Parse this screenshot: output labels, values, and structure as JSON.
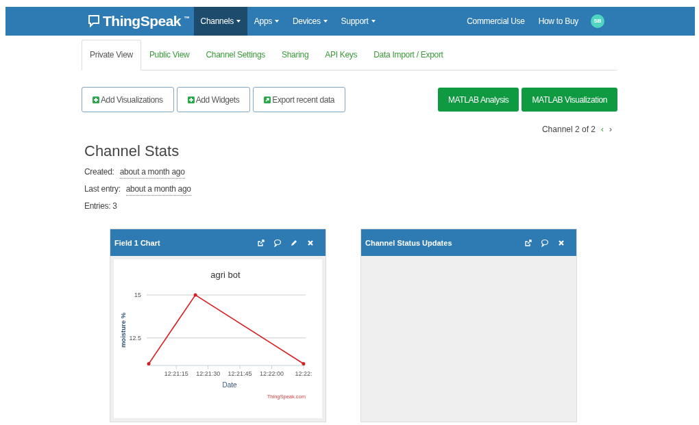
{
  "navbar": {
    "brand": "ThingSpeak",
    "brand_mark": "™",
    "menus": [
      {
        "label": "Channels",
        "selected": true
      },
      {
        "label": "Apps",
        "selected": false
      },
      {
        "label": "Devices",
        "selected": false
      },
      {
        "label": "Support",
        "selected": false
      }
    ],
    "links": [
      "Commercial Use",
      "How to Buy"
    ],
    "avatar": "SB"
  },
  "tabs": [
    {
      "label": "Private View",
      "selected": true
    },
    {
      "label": "Public View",
      "selected": false
    },
    {
      "label": "Channel Settings",
      "selected": false
    },
    {
      "label": "Sharing",
      "selected": false
    },
    {
      "label": "API Keys",
      "selected": false
    },
    {
      "label": "Data Import / Export",
      "selected": false
    }
  ],
  "toolbar": [
    {
      "label": "Add Visualizations",
      "kind": "plus"
    },
    {
      "label": "Add Widgets",
      "kind": "plus"
    },
    {
      "label": "Export recent data",
      "kind": "export"
    }
  ],
  "matlab_buttons": [
    "MATLAB Analysis",
    "MATLAB Visualization"
  ],
  "pager": {
    "text": "Channel 2 of 2",
    "prev": "‹",
    "next": "›"
  },
  "stats": {
    "title": "Channel Stats",
    "rows": [
      {
        "label": "Created:",
        "value": "about a month ago"
      },
      {
        "label": "Last entry:",
        "value": "about a month ago"
      },
      {
        "label": "Entries: 3"
      }
    ]
  },
  "panels": [
    {
      "title": "Field 1 Chart",
      "tools": [
        {
          "kind": "external"
        },
        {
          "kind": "comment"
        },
        {
          "kind": "edit"
        },
        {
          "kind": "close"
        }
      ],
      "credit": "ThingSpeak.com",
      "chart_data": {
        "type": "line",
        "title": "agri bot",
        "xlabel": "Date",
        "ylabel": "moisture %",
        "x": [
          44462,
          44484,
          44535
        ],
        "series": [
          {
            "color": "#d62020",
            "values": [
              11,
              15,
              11
            ]
          }
        ],
        "xlim": [
          44461,
          44536
        ],
        "ylim": [
          10.9,
          15
        ],
        "xticks": [
          {
            "value": 44475,
            "label": "12:21:15"
          },
          {
            "value": 44490,
            "label": "12:21:30"
          },
          {
            "value": 44505,
            "label": "12:21:45"
          },
          {
            "value": 44520,
            "label": "12:22:00"
          },
          {
            "value": 44535,
            "label": "12:22:"
          }
        ],
        "yticks": [
          12.5,
          15
        ]
      }
    },
    {
      "title": "Channel Status Updates",
      "tools": [
        {
          "kind": "external"
        },
        {
          "kind": "comment"
        },
        {
          "kind": "close"
        }
      ]
    }
  ]
}
